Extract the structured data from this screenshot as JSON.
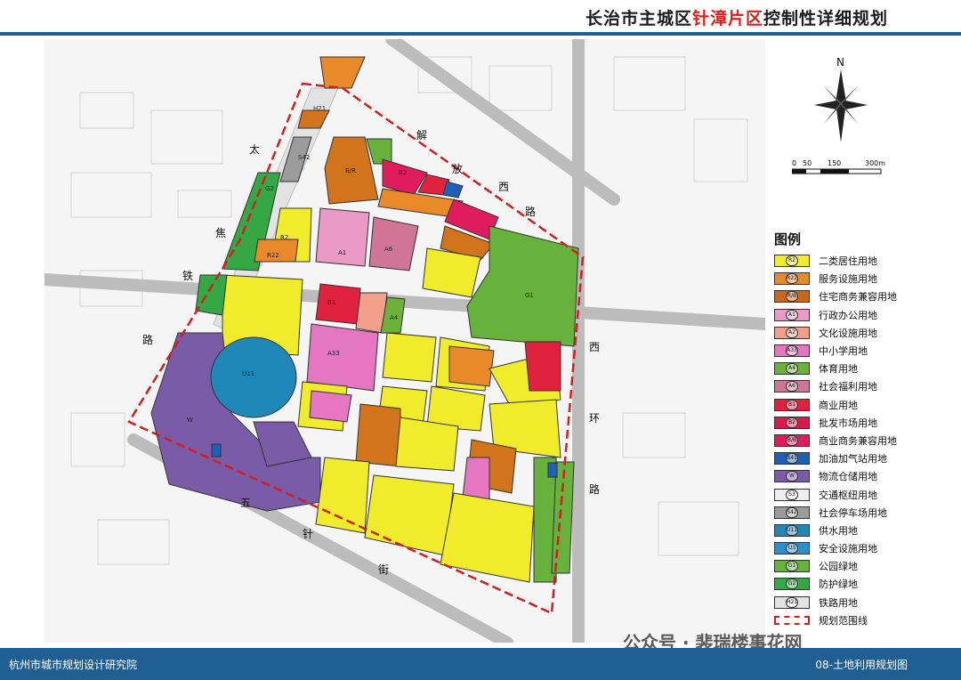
{
  "title": {
    "prefix": "长治市主城区",
    "highlight": "针漳片区",
    "suffix": "控制性详细规划"
  },
  "north_label": "N",
  "scale": {
    "ticks": [
      "0",
      "50",
      "150",
      "300m"
    ]
  },
  "map": {
    "road_labels": [
      {
        "id": "taijiao1",
        "text": "太"
      },
      {
        "id": "taijiao2",
        "text": "焦"
      },
      {
        "id": "taijiao3",
        "text": "铁"
      },
      {
        "id": "taijiao4",
        "text": "路"
      },
      {
        "id": "jiefang1",
        "text": "解"
      },
      {
        "id": "jiefang2",
        "text": "放"
      },
      {
        "id": "jiefang3",
        "text": "西"
      },
      {
        "id": "jiefang4",
        "text": "路"
      },
      {
        "id": "xihuan1",
        "text": "西"
      },
      {
        "id": "xihuan2",
        "text": "环"
      },
      {
        "id": "xihuan3",
        "text": "路"
      },
      {
        "id": "wuzhen1",
        "text": "五"
      },
      {
        "id": "wuzhen2",
        "text": "针"
      },
      {
        "id": "wuzhen3",
        "text": "街"
      }
    ],
    "parcels": [
      {
        "code": "R2",
        "fill": "#f0ec2b"
      },
      {
        "code": "R22",
        "fill": "#e8892a"
      },
      {
        "code": "B/R",
        "fill": "#d2741c"
      },
      {
        "code": "A1",
        "fill": "#ea9ac4"
      },
      {
        "code": "A33",
        "fill": "#e476c2"
      },
      {
        "code": "A4",
        "fill": "#6db13a"
      },
      {
        "code": "A6",
        "fill": "#d07596"
      },
      {
        "code": "B1",
        "fill": "#e1223f"
      },
      {
        "code": "B2",
        "fill": "#d91a4b"
      },
      {
        "code": "W",
        "fill": "#7a5ba7"
      },
      {
        "code": "U11",
        "fill": "#1f88b8"
      },
      {
        "code": "G1",
        "fill": "#67b23c"
      },
      {
        "code": "G2",
        "fill": "#35a845"
      },
      {
        "code": "H21",
        "fill": "#e3e3e3"
      },
      {
        "code": "S42",
        "fill": "#9b9b9b"
      }
    ]
  },
  "legend": {
    "title": "图例",
    "items": [
      {
        "code": "R2",
        "label": "二类居住用地",
        "color": "#f0ec2b"
      },
      {
        "code": "R22",
        "label": "服务设施用地",
        "color": "#e8892a"
      },
      {
        "code": "R/B",
        "label": "住宅商务兼容用地",
        "color": "#c9671b"
      },
      {
        "code": "A1",
        "label": "行政办公用地",
        "color": "#ea9ac4"
      },
      {
        "code": "A2",
        "label": "文化设施用地",
        "color": "#f2a08c"
      },
      {
        "code": "A33",
        "label": "中小学用地",
        "color": "#e476c2"
      },
      {
        "code": "A4",
        "label": "体育用地",
        "color": "#6db13a"
      },
      {
        "code": "A6",
        "label": "社会福利用地",
        "color": "#d07596"
      },
      {
        "code": "B1",
        "label": "商业用地",
        "color": "#e1223f"
      },
      {
        "code": "B2",
        "label": "批发市场用地",
        "color": "#d91a4b"
      },
      {
        "code": "B/B",
        "label": "商业商务兼容用地",
        "color": "#e01c5e"
      },
      {
        "code": "B41",
        "label": "加油加气站用地",
        "color": "#1e5fb8"
      },
      {
        "code": "W",
        "label": "物流仓储用地",
        "color": "#7a5ba7"
      },
      {
        "code": "S3",
        "label": "交通枢纽用地",
        "color": "#eeeeee"
      },
      {
        "code": "S42",
        "label": "社会停车场用地",
        "color": "#9b9b9b"
      },
      {
        "code": "U11",
        "label": "供水用地",
        "color": "#1f88b8"
      },
      {
        "code": "U3",
        "label": "安全设施用地",
        "color": "#2b90c8"
      },
      {
        "code": "G1",
        "label": "公园绿地",
        "color": "#67b23c"
      },
      {
        "code": "G2",
        "label": "防护绿地",
        "color": "#35a845"
      },
      {
        "code": "H21",
        "label": "铁路用地",
        "color": "#e3e3e3"
      }
    ],
    "boundary_label": "规划范围线"
  },
  "footer": {
    "left": "杭州市城市规划设计研究院",
    "right": "08-土地利用规划图"
  },
  "watermark": "公众号 · 裴瑞楼事花网"
}
